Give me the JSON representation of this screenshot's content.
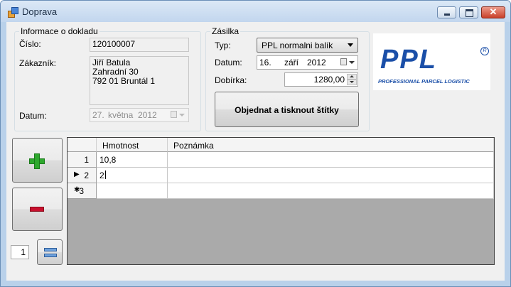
{
  "window": {
    "title": "Doprava"
  },
  "informace": {
    "legend": "Informace o dokladu",
    "cislo_label": "Číslo:",
    "cislo_value": "120100007",
    "zakaznik_label": "Zákazník:",
    "zakaznik_lines": [
      "Jiří Batula",
      "Zahradní 30",
      "792 01 Bruntál 1"
    ],
    "datum_label": "Datum:",
    "datum": {
      "day": "27.",
      "month": "května",
      "year": "2012"
    }
  },
  "zasilka": {
    "legend": "Zásilka",
    "typ_label": "Typ:",
    "typ_value": "PPL normalni balík",
    "datum_label": "Datum:",
    "datum": {
      "day": "16.",
      "month": "září",
      "year": "2012"
    },
    "dobirka_label": "Dobírka:",
    "dobirka_value": "1280,00",
    "order_button": "Objednat a tisknout štítky"
  },
  "logo": {
    "name": "PPL",
    "tagline": "PROFESSIONAL  PARCEL  LOGISTIC",
    "reg_mark": "R",
    "brand_color": "#1b4fa8"
  },
  "side": {
    "add_icon_color": "#2ea82e",
    "remove_icon_color": "#c8102e",
    "count_value": "1"
  },
  "grid": {
    "columns": [
      "Hmotnost",
      "Poznámka"
    ],
    "rows": [
      {
        "row_number": "1",
        "indicator": "",
        "hmotnost": "10,8",
        "poznamka": ""
      },
      {
        "row_number": "2",
        "indicator": "▶",
        "hmotnost": "2",
        "poznamka": ""
      },
      {
        "row_number": "3",
        "indicator": "✱",
        "hmotnost": "",
        "poznamka": ""
      }
    ]
  }
}
